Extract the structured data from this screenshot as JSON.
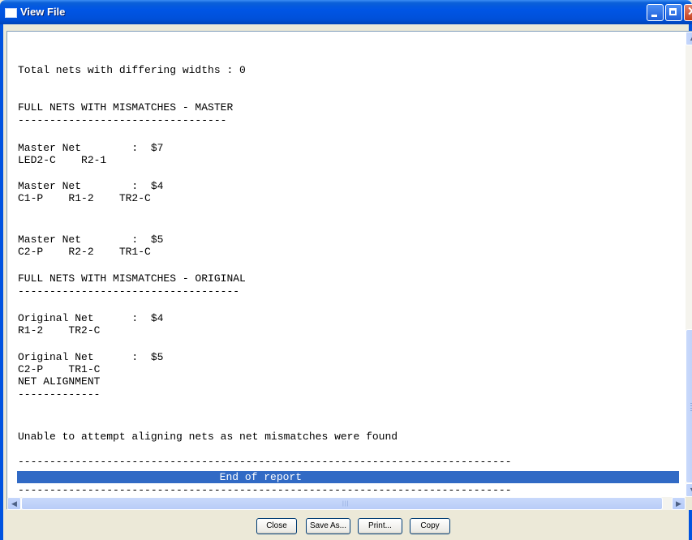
{
  "window": {
    "title": "View File"
  },
  "report": {
    "lines": [
      "Total nets with differing widths : 0",
      "FULL NETS WITH MISMATCHES - MASTER",
      "---------------------------------",
      "Master Net        :  $7",
      "LED2-C    R2-1",
      "Master Net        :  $4",
      "C1-P    R1-2    TR2-C",
      "Master Net        :  $5",
      "C2-P    R2-2    TR1-C",
      "FULL NETS WITH MISMATCHES - ORIGINAL",
      "-----------------------------------",
      "Original Net      :  $4",
      "R1-2    TR2-C",
      "Original Net      :  $5",
      "C2-P    TR1-C",
      "NET ALIGNMENT",
      "-------------",
      "Unable to attempt aligning nets as net mismatches were found",
      "------------------------------------------------------------------------------",
      "                                End of report",
      "------------------------------------------------------------------------------"
    ]
  },
  "buttons": {
    "close": "Close",
    "save_as": "Save As...",
    "print": "Print...",
    "copy": "Copy"
  }
}
